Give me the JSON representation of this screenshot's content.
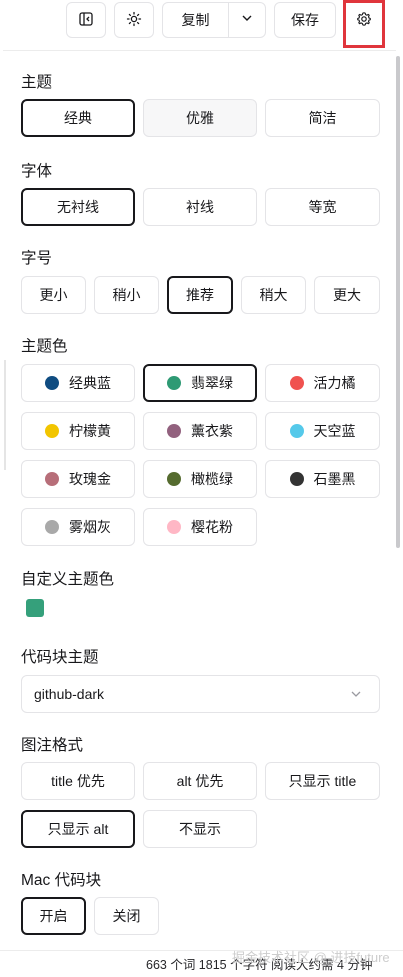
{
  "toolbar": {
    "sidebar_icon": "sidebar-toggle-icon",
    "theme_icon": "sun-icon",
    "copy_label": "复制",
    "copy_dropdown_icon": "chevron-down-icon",
    "save_label": "保存",
    "settings_icon": "gear-icon"
  },
  "theme": {
    "label": "主题",
    "options": [
      "经典",
      "优雅",
      "简洁"
    ],
    "selected": "经典"
  },
  "font": {
    "label": "字体",
    "options": [
      "无衬线",
      "衬线",
      "等宽"
    ],
    "selected": "无衬线"
  },
  "font_size": {
    "label": "字号",
    "options": [
      "更小",
      "稍小",
      "推荐",
      "稍大",
      "更大"
    ],
    "selected": "推荐"
  },
  "theme_color": {
    "label": "主题色",
    "selected": "翡翠绿",
    "options": [
      {
        "name": "经典蓝",
        "color": "#0f4c81"
      },
      {
        "name": "翡翠绿",
        "color": "#2e9a74"
      },
      {
        "name": "活力橘",
        "color": "#f0524f"
      },
      {
        "name": "柠檬黄",
        "color": "#f2c500"
      },
      {
        "name": "薰衣紫",
        "color": "#92617e"
      },
      {
        "name": "天空蓝",
        "color": "#55c9ea"
      },
      {
        "name": "玫瑰金",
        "color": "#b76e79"
      },
      {
        "name": "橄榄绿",
        "color": "#556b2f"
      },
      {
        "name": "石墨黑",
        "color": "#333333"
      },
      {
        "name": "雾烟灰",
        "color": "#a9a9a9"
      },
      {
        "name": "樱花粉",
        "color": "#ffb7c5"
      }
    ]
  },
  "custom_color": {
    "label": "自定义主题色",
    "value": "#35a07b"
  },
  "code_theme": {
    "label": "代码块主题",
    "value": "github-dark"
  },
  "caption": {
    "label": "图注格式",
    "options": [
      "title 优先",
      "alt 优先",
      "只显示 title",
      "只显示 alt",
      "不显示"
    ],
    "selected": "只显示 alt"
  },
  "mac_code": {
    "label": "Mac 代码块",
    "options": [
      "开启",
      "关闭"
    ],
    "selected": "开启"
  },
  "status": {
    "text": "663 个词   1815 个字符   阅读大约需 4 分钟",
    "watermark": "掘金技术社区 @ 进技future"
  }
}
